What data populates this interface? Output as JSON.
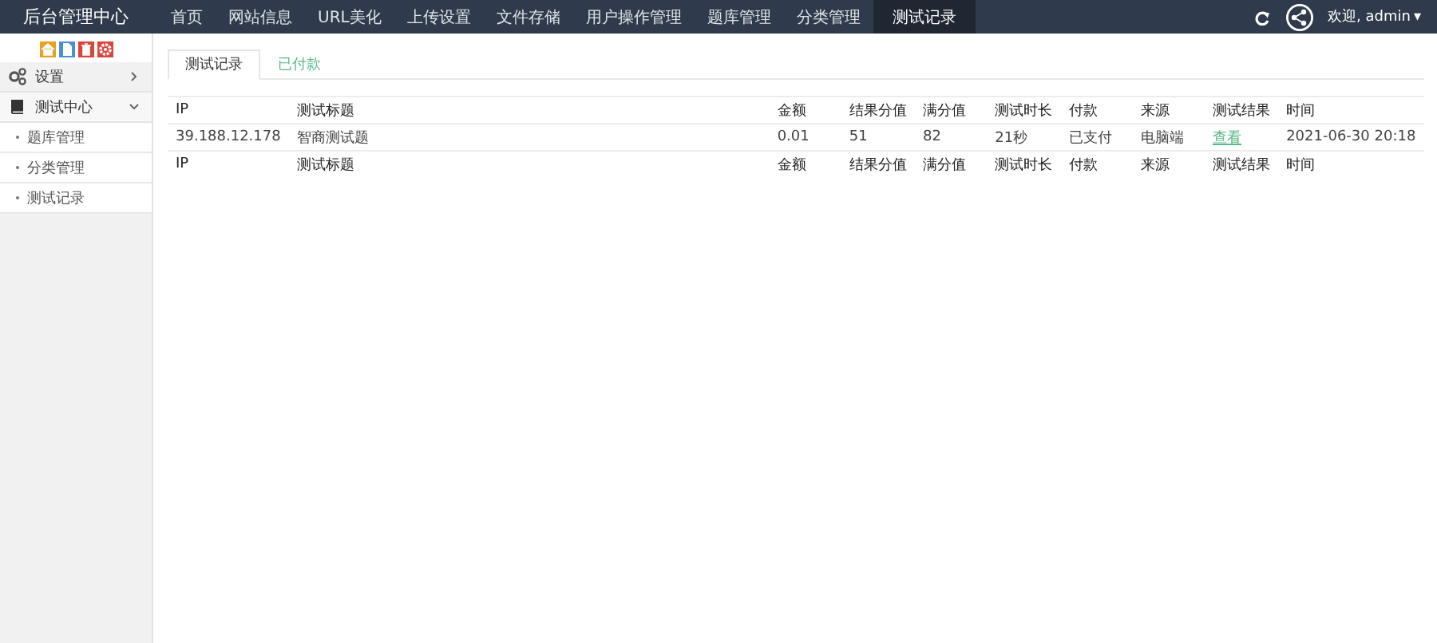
{
  "brand": "后台管理中心",
  "nav": [
    {
      "label": "首页",
      "selected": false
    },
    {
      "label": "网站信息",
      "selected": false
    },
    {
      "label": "URL美化",
      "selected": false
    },
    {
      "label": "上传设置",
      "selected": false
    },
    {
      "label": "文件存储",
      "selected": false
    },
    {
      "label": "用户操作管理",
      "selected": false
    },
    {
      "label": "题库管理",
      "selected": false
    },
    {
      "label": "分类管理",
      "selected": false
    },
    {
      "label": "测试记录",
      "selected": true
    }
  ],
  "user": {
    "greeting": "欢迎, admin",
    "caret": "▾"
  },
  "toolbar": [
    {
      "kind": "home",
      "color": "#e8a21e"
    },
    {
      "kind": "file",
      "color": "#4b8fd6"
    },
    {
      "kind": "trash",
      "color": "#d9453d"
    },
    {
      "kind": "gear",
      "color": "#d9453d"
    }
  ],
  "sidebar": {
    "items": [
      {
        "label": "设置",
        "kind": "gears",
        "expanded": false
      },
      {
        "label": "测试中心",
        "kind": "book",
        "expanded": true,
        "children": [
          {
            "label": "题库管理",
            "selected": false
          },
          {
            "label": "分类管理",
            "selected": false
          },
          {
            "label": "测试记录",
            "selected": false
          }
        ]
      }
    ]
  },
  "tabs": [
    {
      "label": "测试记录",
      "selected": true
    },
    {
      "label": "已付款",
      "selected": false
    }
  ],
  "table": {
    "columns": [
      {
        "label": "IP",
        "kind": "text"
      },
      {
        "label": "测试标题",
        "kind": "text"
      },
      {
        "label": "金额",
        "kind": "text"
      },
      {
        "label": "结果分值",
        "kind": "text"
      },
      {
        "label": "满分值",
        "kind": "text"
      },
      {
        "label": "测试时长",
        "kind": "text"
      },
      {
        "label": "付款",
        "kind": "text"
      },
      {
        "label": "来源",
        "kind": "text"
      },
      {
        "label": "测试结果",
        "kind": "link"
      },
      {
        "label": "时间",
        "kind": "text"
      }
    ],
    "rows": [
      [
        "39.188.12.178",
        "智商测试题",
        "0.01",
        "51",
        "82",
        "21秒",
        "已支付",
        "电脑端",
        "查看",
        "2021-06-30 20:18"
      ]
    ],
    "footer": [
      "IP",
      "测试标题",
      "金额",
      "结果分值",
      "满分值",
      "测试时长",
      "付款",
      "来源",
      "测试结果",
      "时间"
    ]
  }
}
